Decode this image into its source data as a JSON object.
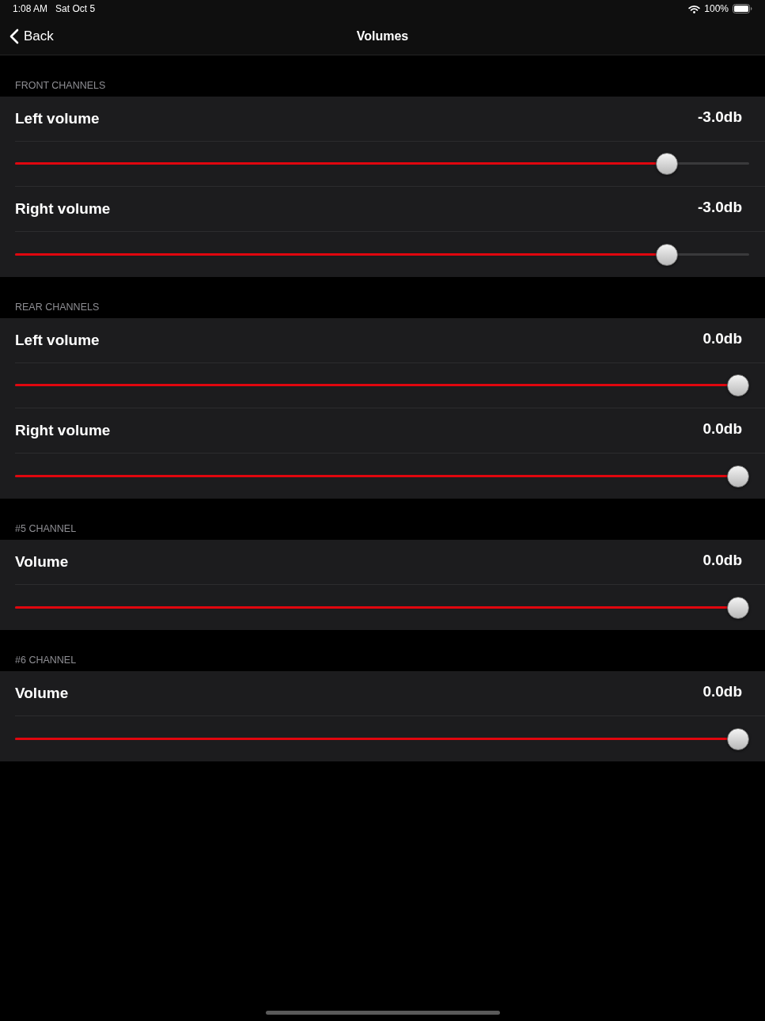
{
  "status_bar": {
    "time": "1:08 AM",
    "date": "Sat Oct 5",
    "battery": "100%"
  },
  "nav": {
    "back": "Back",
    "title": "Volumes"
  },
  "sections": [
    {
      "header": "FRONT CHANNELS",
      "channels": [
        {
          "name": "Left volume",
          "reading": "-3.0db",
          "level": 0.9
        },
        {
          "name": "Right volume",
          "reading": "-3.0db",
          "level": 0.9
        }
      ]
    },
    {
      "header": "REAR CHANNELS",
      "channels": [
        {
          "name": "Left volume",
          "reading": "0.0db",
          "level": 1
        },
        {
          "name": "Right volume",
          "reading": "0.0db",
          "level": 1
        }
      ]
    },
    {
      "header": "#5 CHANNEL",
      "channels": [
        {
          "name": "Volume",
          "reading": "0.0db",
          "level": 1
        }
      ]
    },
    {
      "header": "#6 CHANNEL",
      "channels": [
        {
          "name": "Volume",
          "reading": "0.0db",
          "level": 1
        }
      ]
    }
  ]
}
